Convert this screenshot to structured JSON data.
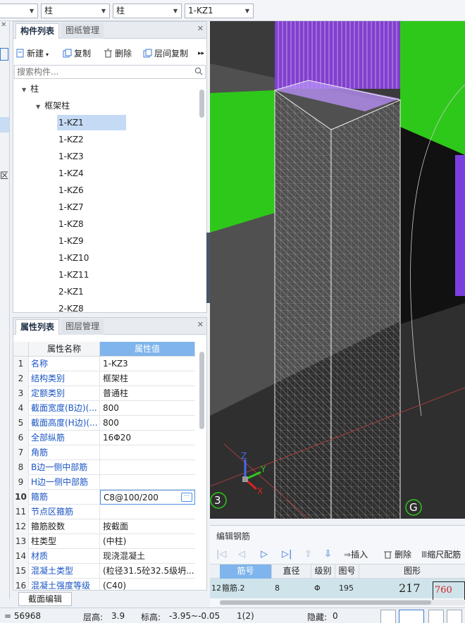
{
  "topbar": {
    "dropdowns": [
      {
        "value": ""
      },
      {
        "value": "柱"
      },
      {
        "value": "柱"
      },
      {
        "value": "1-KZ1"
      }
    ]
  },
  "left_strip": {
    "char": "区"
  },
  "component_panel": {
    "tabs": [
      {
        "label": "构件列表"
      },
      {
        "label": "图纸管理"
      }
    ],
    "toolbar": {
      "new_label": "新建",
      "copy_label": "复制",
      "delete_label": "删除",
      "floor_copy_label": "层间复制",
      "more": "▸▸"
    },
    "search_placeholder": "搜索构件...",
    "tree": {
      "root": "柱",
      "group": "框架柱",
      "selected": "1-KZ1",
      "items": [
        "1-KZ1",
        "1-KZ2",
        "1-KZ3",
        "1-KZ4",
        "1-KZ6",
        "1-KZ7",
        "1-KZ8",
        "1-KZ9",
        "1-KZ10",
        "1-KZ11",
        "2-KZ1",
        "2-KZ8"
      ]
    }
  },
  "property_panel": {
    "tabs": [
      {
        "label": "属性列表"
      },
      {
        "label": "图层管理"
      }
    ],
    "header": {
      "name": "属性名称",
      "value": "属性值"
    },
    "rows": [
      {
        "num": "1",
        "name": "名称",
        "value": "1-KZ3",
        "blue": true
      },
      {
        "num": "2",
        "name": "结构类别",
        "value": "框架柱",
        "blue": true
      },
      {
        "num": "3",
        "name": "定额类别",
        "value": "普通柱",
        "blue": true
      },
      {
        "num": "4",
        "name": "截面宽度(B边)(...",
        "value": "800",
        "blue": true
      },
      {
        "num": "5",
        "name": "截面高度(H边)(...",
        "value": "800",
        "blue": true
      },
      {
        "num": "6",
        "name": "全部纵筋",
        "value": "16Φ20",
        "blue": true
      },
      {
        "num": "7",
        "name": "角筋",
        "value": "",
        "blue": true
      },
      {
        "num": "8",
        "name": "B边一侧中部筋",
        "value": "",
        "blue": true
      },
      {
        "num": "9",
        "name": "H边一侧中部筋",
        "value": "",
        "blue": true
      },
      {
        "num": "10",
        "name": "箍筋",
        "value": "C8@100/200",
        "blue": true,
        "active": true
      },
      {
        "num": "11",
        "name": "节点区箍筋",
        "value": "",
        "blue": true
      },
      {
        "num": "12",
        "name": "箍筋胶数",
        "value": "按截面",
        "blue": false
      },
      {
        "num": "13",
        "name": "柱类型",
        "value": "(中柱)",
        "blue": false
      },
      {
        "num": "14",
        "name": "材质",
        "value": "现浇混凝土",
        "blue": true
      },
      {
        "num": "15",
        "name": "混凝土类型",
        "value": "(粒径31.5砼32.5级坍...",
        "blue": true
      },
      {
        "num": "16",
        "name": "混凝土强度等级",
        "value": "(C40)",
        "blue": true
      }
    ],
    "ellipsis": "···"
  },
  "section_edit_label": "截面编辑",
  "viewport": {
    "axis_3": "3",
    "axis_g": "G",
    "axis_x": "X",
    "axis_y": "Y",
    "axis_z": "Z"
  },
  "rebar_editor": {
    "title": "编辑钢筋",
    "insert_label": "插入",
    "delete_label": "删除",
    "scale_label": "缩尺配筋",
    "columns": [
      "筋号",
      "直径(mm)",
      "级别",
      "图号",
      "图形"
    ],
    "row": {
      "index": "12",
      "name": "箍筋.2",
      "diameter": "8",
      "grade": "Φ",
      "figure": "195",
      "shape_value": "217",
      "shape_value2": "760"
    }
  },
  "statusbar": {
    "coord": "= 56968",
    "floor_height_label": "层高:",
    "floor_height": "3.9",
    "elevation_label": "标高:",
    "elevation": "-3.95~-0.05",
    "page": "1(2)",
    "hidden_label": "隐藏:",
    "hidden": "0"
  },
  "colors": {
    "accent": "#7fb4ec",
    "purple": "#8a3fe0",
    "green": "#2ec81a",
    "label_blue": "#1a55c4"
  }
}
